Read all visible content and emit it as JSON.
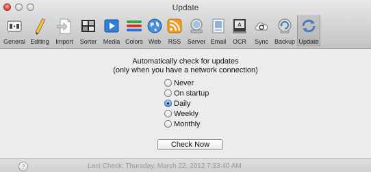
{
  "window": {
    "title": "Update"
  },
  "toolbar": {
    "items": [
      {
        "label": "General",
        "icon": "general-switch-icon"
      },
      {
        "label": "Editing",
        "icon": "pencil-icon"
      },
      {
        "label": "Import",
        "icon": "import-document-icon"
      },
      {
        "label": "Sorter",
        "icon": "sorter-icon"
      },
      {
        "label": "Media",
        "icon": "media-play-icon"
      },
      {
        "label": "Colors",
        "icon": "colors-stripes-icon"
      },
      {
        "label": "Web",
        "icon": "globe-icon"
      },
      {
        "label": "RSS",
        "icon": "rss-icon"
      },
      {
        "label": "Server",
        "icon": "server-icon"
      },
      {
        "label": "Email",
        "icon": "email-icon"
      },
      {
        "label": "OCR",
        "icon": "ocr-scanner-icon"
      },
      {
        "label": "Sync",
        "icon": "sync-cloud-icon"
      },
      {
        "label": "Backup",
        "icon": "backup-icon"
      },
      {
        "label": "Update",
        "icon": "update-arrows-icon"
      }
    ],
    "selected": "Update"
  },
  "update": {
    "heading_line1": "Automatically check for updates",
    "heading_line2": "(only when you have a network connection)",
    "options": [
      "Never",
      "On startup",
      "Daily",
      "Weekly",
      "Monthly"
    ],
    "selected_option": "Daily",
    "check_now_label": "Check Now"
  },
  "footer": {
    "help_label": "?",
    "last_check": "Last  Check:  Thursday,  March 22,  2012  7:33:40 AM"
  },
  "colors": {
    "accent": "#3d6db3",
    "close_button": "#e0463b",
    "window_bg": "#ececec"
  }
}
